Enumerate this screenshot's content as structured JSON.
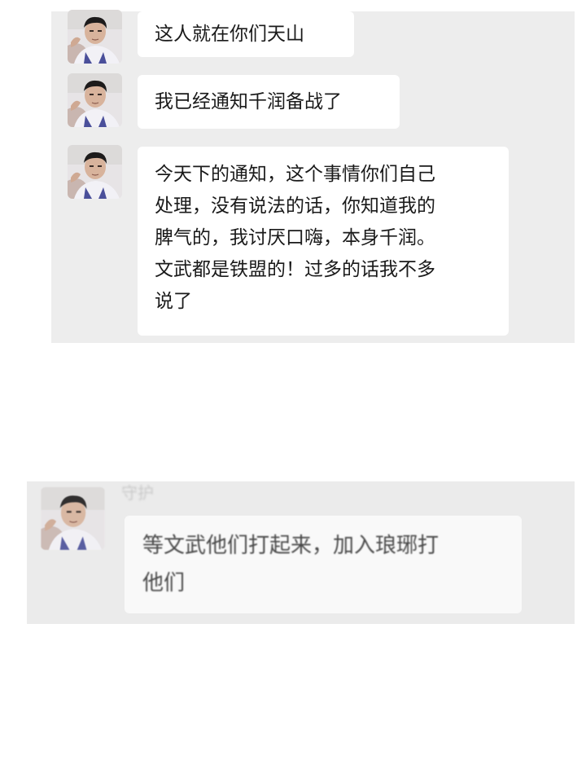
{
  "chat_top": {
    "messages": [
      {
        "sender_avatar": "avatar-young-man",
        "lines": [
          "这人就在你们天山"
        ]
      },
      {
        "sender_avatar": "avatar-young-man",
        "lines": [
          "我已经通知千润备战了"
        ]
      },
      {
        "sender_avatar": "avatar-young-man",
        "lines": [
          "今天下的通知，这个事情你们自己",
          "处理，没有说法的话，你知道我的",
          "脾气的，我讨厌口嗨，本身千润。",
          "文武都是铁盟的！过多的话我不多",
          "说了"
        ]
      }
    ]
  },
  "chat_bottom": {
    "sender_name": "守护",
    "messages": [
      {
        "sender_avatar": "avatar-young-man",
        "lines": [
          "等文武他们打起来，加入琅琊打",
          "他们"
        ]
      }
    ]
  },
  "colors": {
    "chat_background": "#ededed",
    "bubble_background": "#ffffff",
    "text": "#1a1a1a"
  }
}
